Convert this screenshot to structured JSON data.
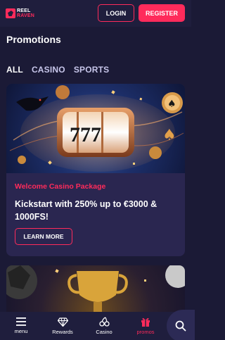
{
  "brand": {
    "logo_line1": "REEL",
    "logo_line2": "RAVEN",
    "accent": "#ff2b5b"
  },
  "header": {
    "login_label": "LOGIN",
    "register_label": "REGISTER"
  },
  "page": {
    "title": "Promotions"
  },
  "filters": {
    "all": "ALL",
    "casino": "CASINO",
    "sports": "SPORTS"
  },
  "promo": {
    "tag": "Welcome Casino Package",
    "title": "Kickstart with 250% up to €3000 & 1000FS!",
    "cta_label": "LEARN MORE",
    "slot_digits": "777"
  },
  "nav": {
    "menu": "menu",
    "rewards": "Rewards",
    "casino": "Casino",
    "promos": "promos"
  },
  "icons": {
    "menu": "hamburger-icon",
    "rewards": "diamond-icon",
    "casino": "cherries-icon",
    "promos": "gift-icon",
    "search": "search-icon"
  }
}
